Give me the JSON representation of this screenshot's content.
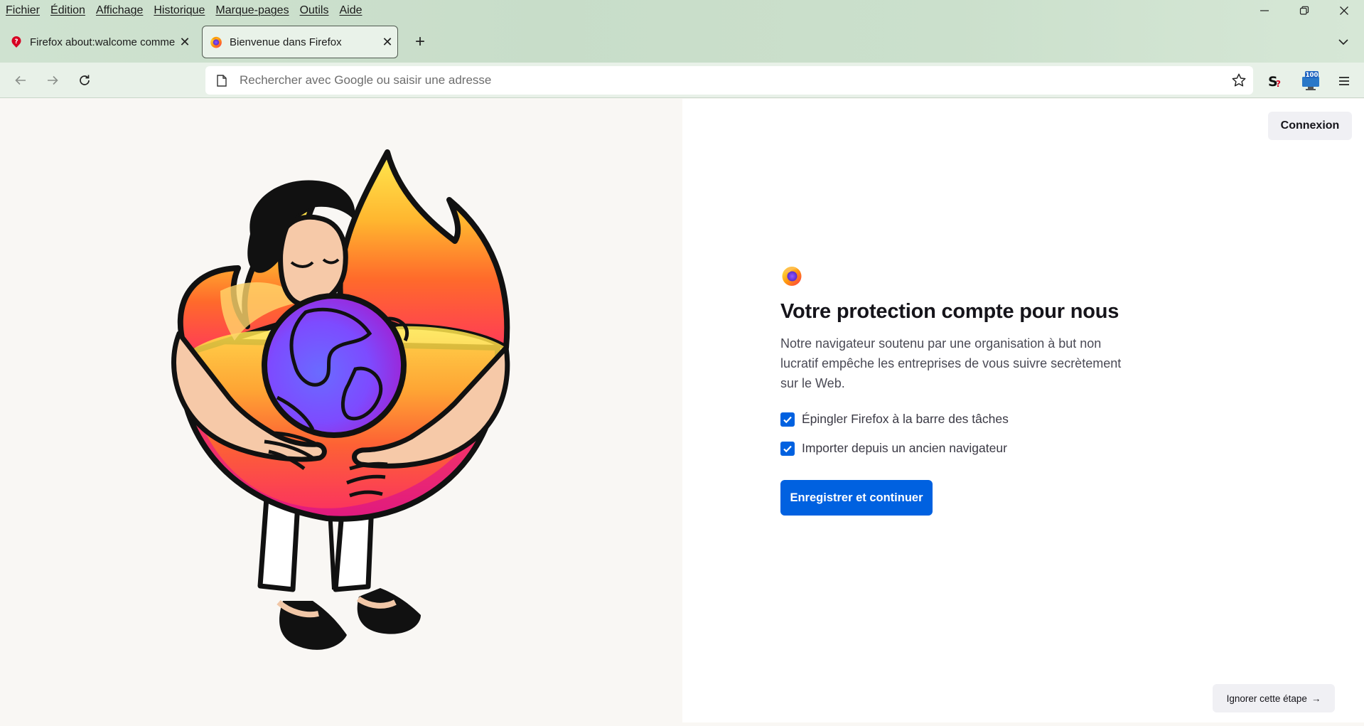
{
  "menubar": {
    "items": [
      "Fichier",
      "Édition",
      "Affichage",
      "Historique",
      "Marque-pages",
      "Outils",
      "Aide"
    ]
  },
  "window_controls": {
    "minimize": "—",
    "restore": "❐",
    "close": "✕"
  },
  "tabs": [
    {
      "title": "Firefox about:walcome commer",
      "close": "✕",
      "icon": "question-icon"
    },
    {
      "title": "Bienvenue dans Firefox",
      "close": "✕",
      "icon": "firefox-logo-icon"
    }
  ],
  "newtab_label": "+",
  "urlbar": {
    "placeholder": "Rechercher avec Google ou saisir une adresse",
    "value": ""
  },
  "extensions": {
    "badge_count": "100"
  },
  "content": {
    "signin_label": "Connexion",
    "title": "Votre protection compte pour nous",
    "description": "Notre navigateur soutenu par une organisation à but non lucratif empêche les entreprises de vous suivre secrètement sur le Web.",
    "options": [
      {
        "label": "Épingler Firefox à la barre des tâches",
        "checked": true
      },
      {
        "label": "Importer depuis un ancien navigateur",
        "checked": true
      }
    ],
    "primary_label": "Enregistrer et continuer",
    "skip_label": "Ignorer cette étape",
    "skip_arrow": "→"
  },
  "colors": {
    "accent": "#0061e0",
    "chrome_bg": "#cfe2d0",
    "toolbar_bg": "#e8f1e8",
    "left_bg": "#f9f7f4"
  }
}
